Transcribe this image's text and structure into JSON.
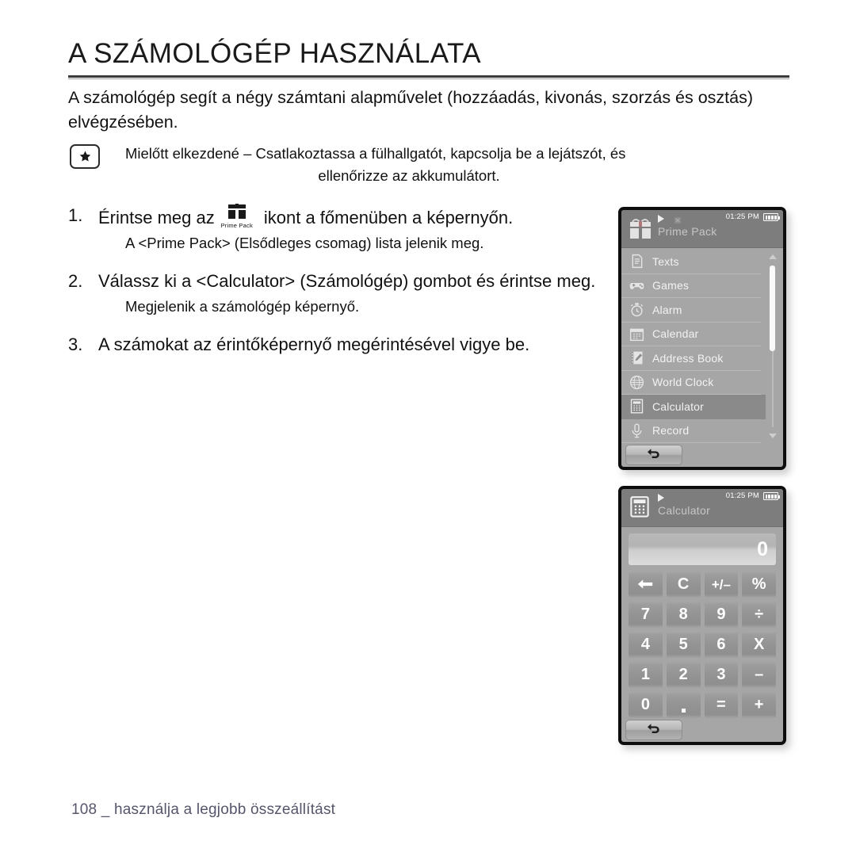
{
  "document": {
    "title": "A SZÁMOLÓGÉP HASZNÁLATA",
    "intro": "A számológép segít a négy számtani alapművelet (hozzáadás, kivonás, szorzás és osztás) elvégzésében.",
    "note": {
      "icon": "star-badge-icon",
      "line1": "Mielőtt elkezdené – Csatlakoztassa a fülhallgatót, kapcsolja be a lejátszót, és",
      "line2": "ellenőrizze az akkumulátort."
    },
    "steps": [
      {
        "number": "1.",
        "text_before": "Érintse meg az",
        "inline_icon_caption": "Prime Pack",
        "text_after": "ikont a főmenüben a képernyőn.",
        "sub": "A <Prime Pack> (Elsődleges csomag) lista jelenik meg."
      },
      {
        "number": "2.",
        "text": "Válassz ki a <Calculator> (Számológép) gombot és érintse meg.",
        "sub": "Megjelenik a számológép képernyő."
      },
      {
        "number": "3.",
        "text": "A számokat az érintőképernyő megérintésével vigye be.",
        "sub": ""
      }
    ],
    "footer": "108 _ használja a legjobb összeállítást"
  },
  "device_prime_pack": {
    "status": {
      "time": "01:25 PM",
      "play_icon": "play-icon",
      "misc_icon": "status-misc-icon",
      "battery_icon": "battery-full-icon"
    },
    "header_icon": "gift-box-icon",
    "header_title": "Prime Pack",
    "list": [
      {
        "icon": "texts-icon",
        "label": "Texts",
        "selected": false
      },
      {
        "icon": "games-icon",
        "label": "Games",
        "selected": false
      },
      {
        "icon": "alarm-icon",
        "label": "Alarm",
        "selected": false
      },
      {
        "icon": "calendar-icon",
        "label": "Calendar",
        "selected": false
      },
      {
        "icon": "address-book-icon",
        "label": "Address Book",
        "selected": false
      },
      {
        "icon": "world-clock-icon",
        "label": "World Clock",
        "selected": false
      },
      {
        "icon": "calculator-icon",
        "label": "Calculator",
        "selected": true
      },
      {
        "icon": "record-icon",
        "label": "Record",
        "selected": false
      }
    ],
    "scrollbar": {
      "up_icon": "scroll-up-arrow-icon",
      "down_icon": "scroll-down-arrow-icon"
    },
    "back_button_icon": "back-arrow-icon"
  },
  "device_calculator": {
    "status": {
      "time": "01:25 PM",
      "play_icon": "play-icon",
      "battery_icon": "battery-full-icon"
    },
    "header_icon": "calculator-icon",
    "header_title": "Calculator",
    "display_value": "0",
    "keys": [
      {
        "name": "backspace",
        "label": "←",
        "size": "normal"
      },
      {
        "name": "clear",
        "label": "C",
        "size": "normal"
      },
      {
        "name": "sign",
        "label": "+/–",
        "size": "small"
      },
      {
        "name": "percent",
        "label": "%",
        "size": "normal"
      },
      {
        "name": "seven",
        "label": "7",
        "size": "normal"
      },
      {
        "name": "eight",
        "label": "8",
        "size": "normal"
      },
      {
        "name": "nine",
        "label": "9",
        "size": "normal"
      },
      {
        "name": "divide",
        "label": "÷",
        "size": "normal"
      },
      {
        "name": "four",
        "label": "4",
        "size": "normal"
      },
      {
        "name": "five",
        "label": "5",
        "size": "normal"
      },
      {
        "name": "six",
        "label": "6",
        "size": "normal"
      },
      {
        "name": "multiply",
        "label": "X",
        "size": "normal"
      },
      {
        "name": "one",
        "label": "1",
        "size": "normal"
      },
      {
        "name": "two",
        "label": "2",
        "size": "normal"
      },
      {
        "name": "three",
        "label": "3",
        "size": "normal"
      },
      {
        "name": "minus",
        "label": "–",
        "size": "normal"
      },
      {
        "name": "zero",
        "label": "0",
        "size": "normal"
      },
      {
        "name": "decimal",
        "label": ".",
        "size": "normal"
      },
      {
        "name": "equals",
        "label": "=",
        "size": "normal"
      },
      {
        "name": "plus",
        "label": "+",
        "size": "normal"
      }
    ],
    "back_button_icon": "back-arrow-icon"
  },
  "colors": {
    "page_background": "#ffffff",
    "text": "#111111",
    "footer_text": "#55566b",
    "device_bezel": "#0d0d0d",
    "screen_background": "#a6a6a6",
    "screen_header": "#7d7d7d",
    "selected_row": "#8a8a8a",
    "label_text": "#f2f2f2"
  }
}
